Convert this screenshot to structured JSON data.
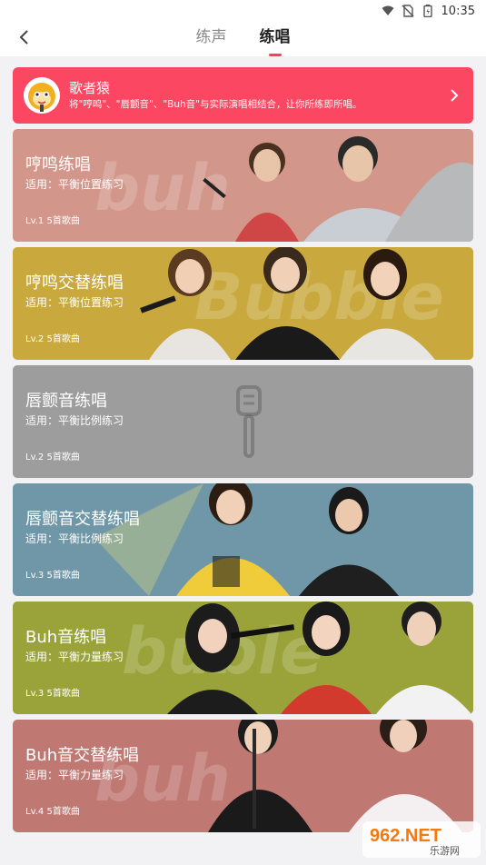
{
  "status_bar": {
    "time": "10:35"
  },
  "nav": {
    "tabs": [
      {
        "label": "练声",
        "active": false
      },
      {
        "label": "练唱",
        "active": true
      }
    ]
  },
  "banner": {
    "title": "歌者猿",
    "subtitle": "将\"哼鸣\"、\"唇颤音\"、\"Buh音\"与实际演唱相结合，让你所练即所唱。"
  },
  "courses": [
    {
      "title": "哼鸣练唱",
      "subtitle": "适用：平衡位置练习",
      "level": "Lv.1",
      "count": "5首歌曲",
      "color": "#d2968a"
    },
    {
      "title": "哼鸣交替练唱",
      "subtitle": "适用：平衡位置练习",
      "level": "Lv.2",
      "count": "5首歌曲",
      "color": "#c9a93d"
    },
    {
      "title": "唇颤音练唱",
      "subtitle": "适用：平衡比例练习",
      "level": "Lv.2",
      "count": "5首歌曲",
      "color": "#9d9d9d"
    },
    {
      "title": "唇颤音交替练唱",
      "subtitle": "适用：平衡比例练习",
      "level": "Lv.3",
      "count": "5首歌曲",
      "color": "#6f97a8"
    },
    {
      "title": "Buh音练唱",
      "subtitle": "适用：平衡力量练习",
      "level": "Lv.3",
      "count": "5首歌曲",
      "color": "#9aa33a"
    },
    {
      "title": "Buh音交替练唱",
      "subtitle": "适用：平衡力量练习",
      "level": "Lv.4",
      "count": "5首歌曲",
      "color": "#c07873"
    }
  ],
  "watermark": {
    "brand": "962.NET",
    "sub": "乐游网"
  },
  "colors": {
    "accent": "#ff3d5d",
    "banner": "#fb4761"
  }
}
